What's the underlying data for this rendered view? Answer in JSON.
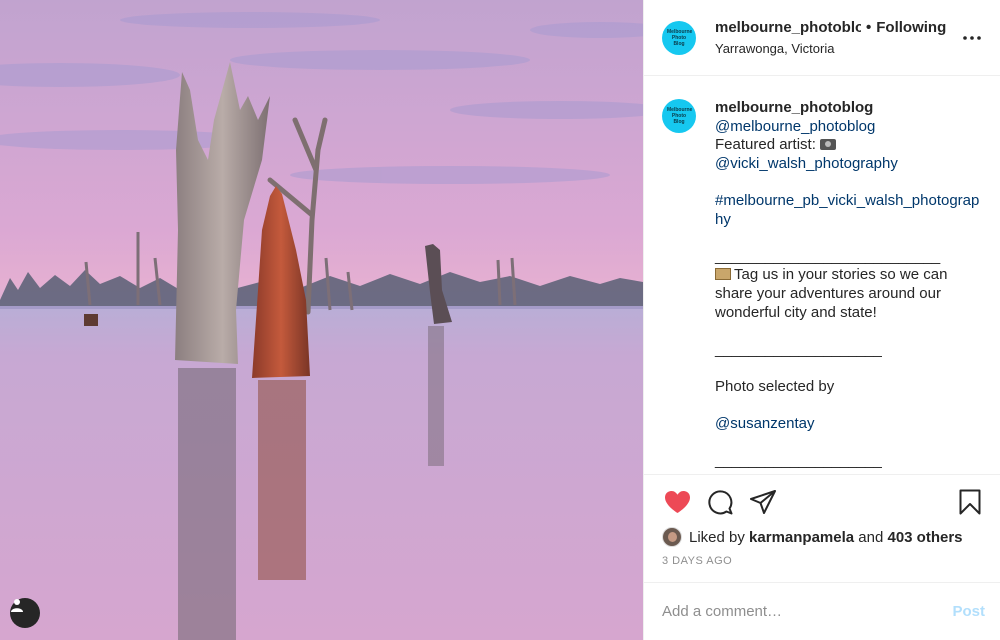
{
  "post": {
    "username": "melbourne_photoblog",
    "separator": "•",
    "follow_label": "Following",
    "location": "Yarrawonga, Victoria",
    "avatar_text": "Melbourne Photo Blog"
  },
  "caption": {
    "username": "melbourne_photoblog",
    "mention_1": "@melbourne_photoblog",
    "featured_label": "Featured artist:",
    "artist_mention": "@vicki_walsh_photography",
    "hashtag": "#melbourne_pb_vicki_walsh_photography",
    "divider_1": "___________________________",
    "tag_text": "Tag us in your stories so we can share your adventures around our wonderful city and state!",
    "divider_2": "____________________",
    "selected_by": "Photo selected by",
    "selector_mention": "@susanzentay",
    "divider_3": "____________________",
    "ellipsis": "...."
  },
  "likes": {
    "prefix": "Liked by",
    "user": "karmanpamela",
    "conjunction": "and",
    "others": "403 others"
  },
  "timestamp": "3 DAYS AGO",
  "comment": {
    "placeholder": "Add a comment…",
    "post_label": "Post"
  },
  "icons": {
    "like": "heart-icon",
    "comment": "comment-icon",
    "share": "share-icon",
    "save": "bookmark-icon",
    "more": "more-icon",
    "user_tag": "user-icon"
  },
  "colors": {
    "like_red": "#ed4956",
    "link_blue": "#00376b",
    "post_disabled": "#b2dffc",
    "avatar_cyan": "#16c8f0"
  }
}
